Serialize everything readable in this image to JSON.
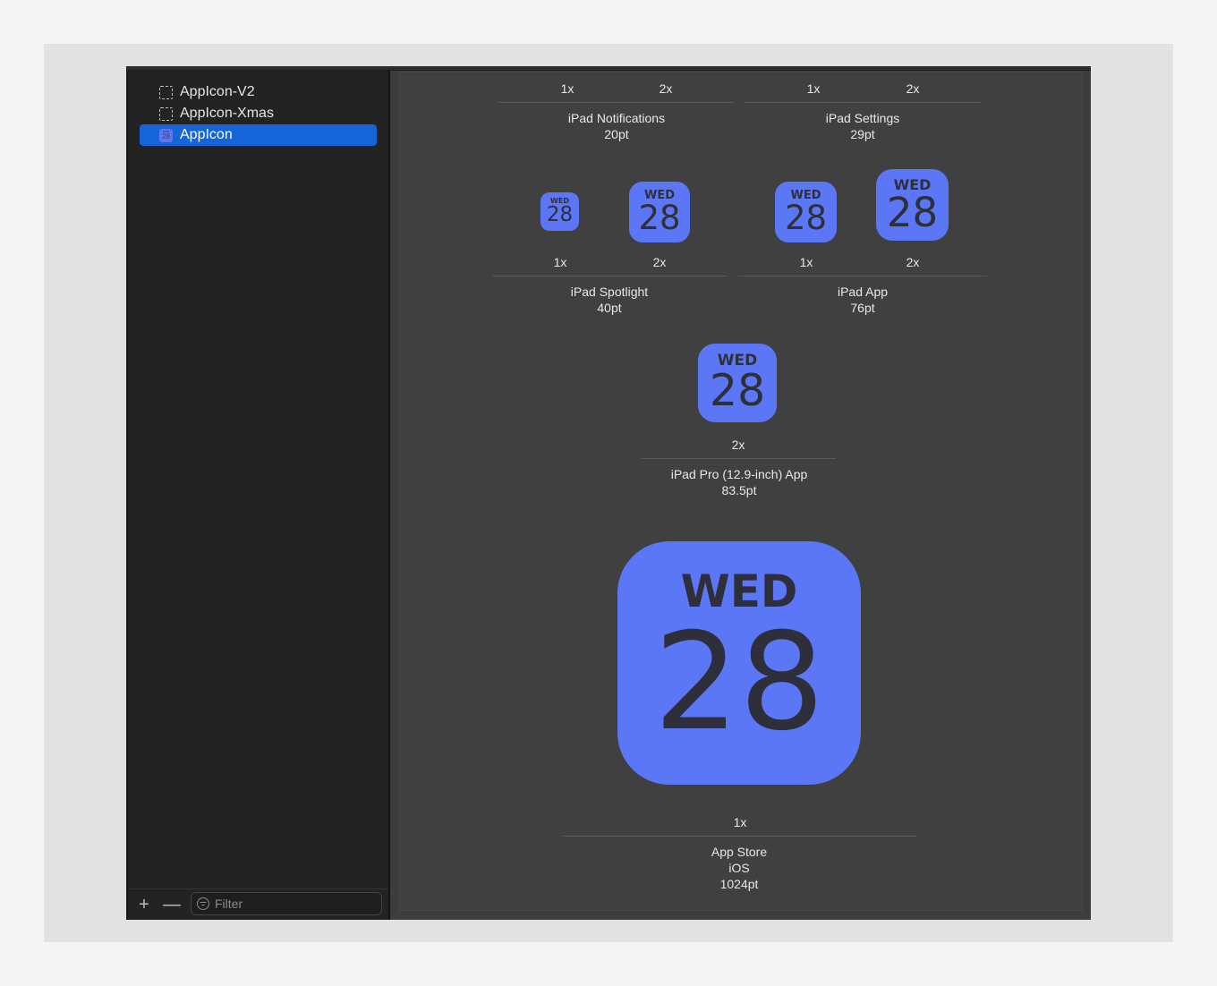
{
  "sidebar": {
    "items": [
      {
        "label": "AppIcon-V2",
        "icon": "empty-image-set-icon",
        "selected": false
      },
      {
        "label": "AppIcon-Xmas",
        "icon": "empty-image-set-icon",
        "selected": false
      },
      {
        "label": "AppIcon",
        "icon": "app-icon-thumbnail",
        "selected": true
      }
    ],
    "footer": {
      "add_label": "+",
      "remove_label": "—",
      "filter_placeholder": "Filter",
      "filter_value": ""
    }
  },
  "icon": {
    "day": "WED",
    "date": "28",
    "color": "#5b77f5",
    "text_color": "#2e2f3a"
  },
  "groups": {
    "ipad_notifications": {
      "title": "iPad Notifications",
      "size": "20pt",
      "scales": [
        "1x",
        "2x"
      ]
    },
    "ipad_settings": {
      "title": "iPad Settings",
      "size": "29pt",
      "scales": [
        "1x",
        "2x"
      ]
    },
    "ipad_spotlight": {
      "title": "iPad Spotlight",
      "size": "40pt",
      "scales": [
        "1x",
        "2x"
      ]
    },
    "ipad_app": {
      "title": "iPad App",
      "size": "76pt",
      "scales": [
        "1x",
        "2x"
      ]
    },
    "ipad_pro_app": {
      "title": "iPad Pro (12.9-inch) App",
      "size": "83.5pt",
      "scales": [
        "2x"
      ]
    },
    "app_store": {
      "title": "App Store",
      "platform": "iOS",
      "size": "1024pt",
      "scales": [
        "1x"
      ]
    }
  }
}
